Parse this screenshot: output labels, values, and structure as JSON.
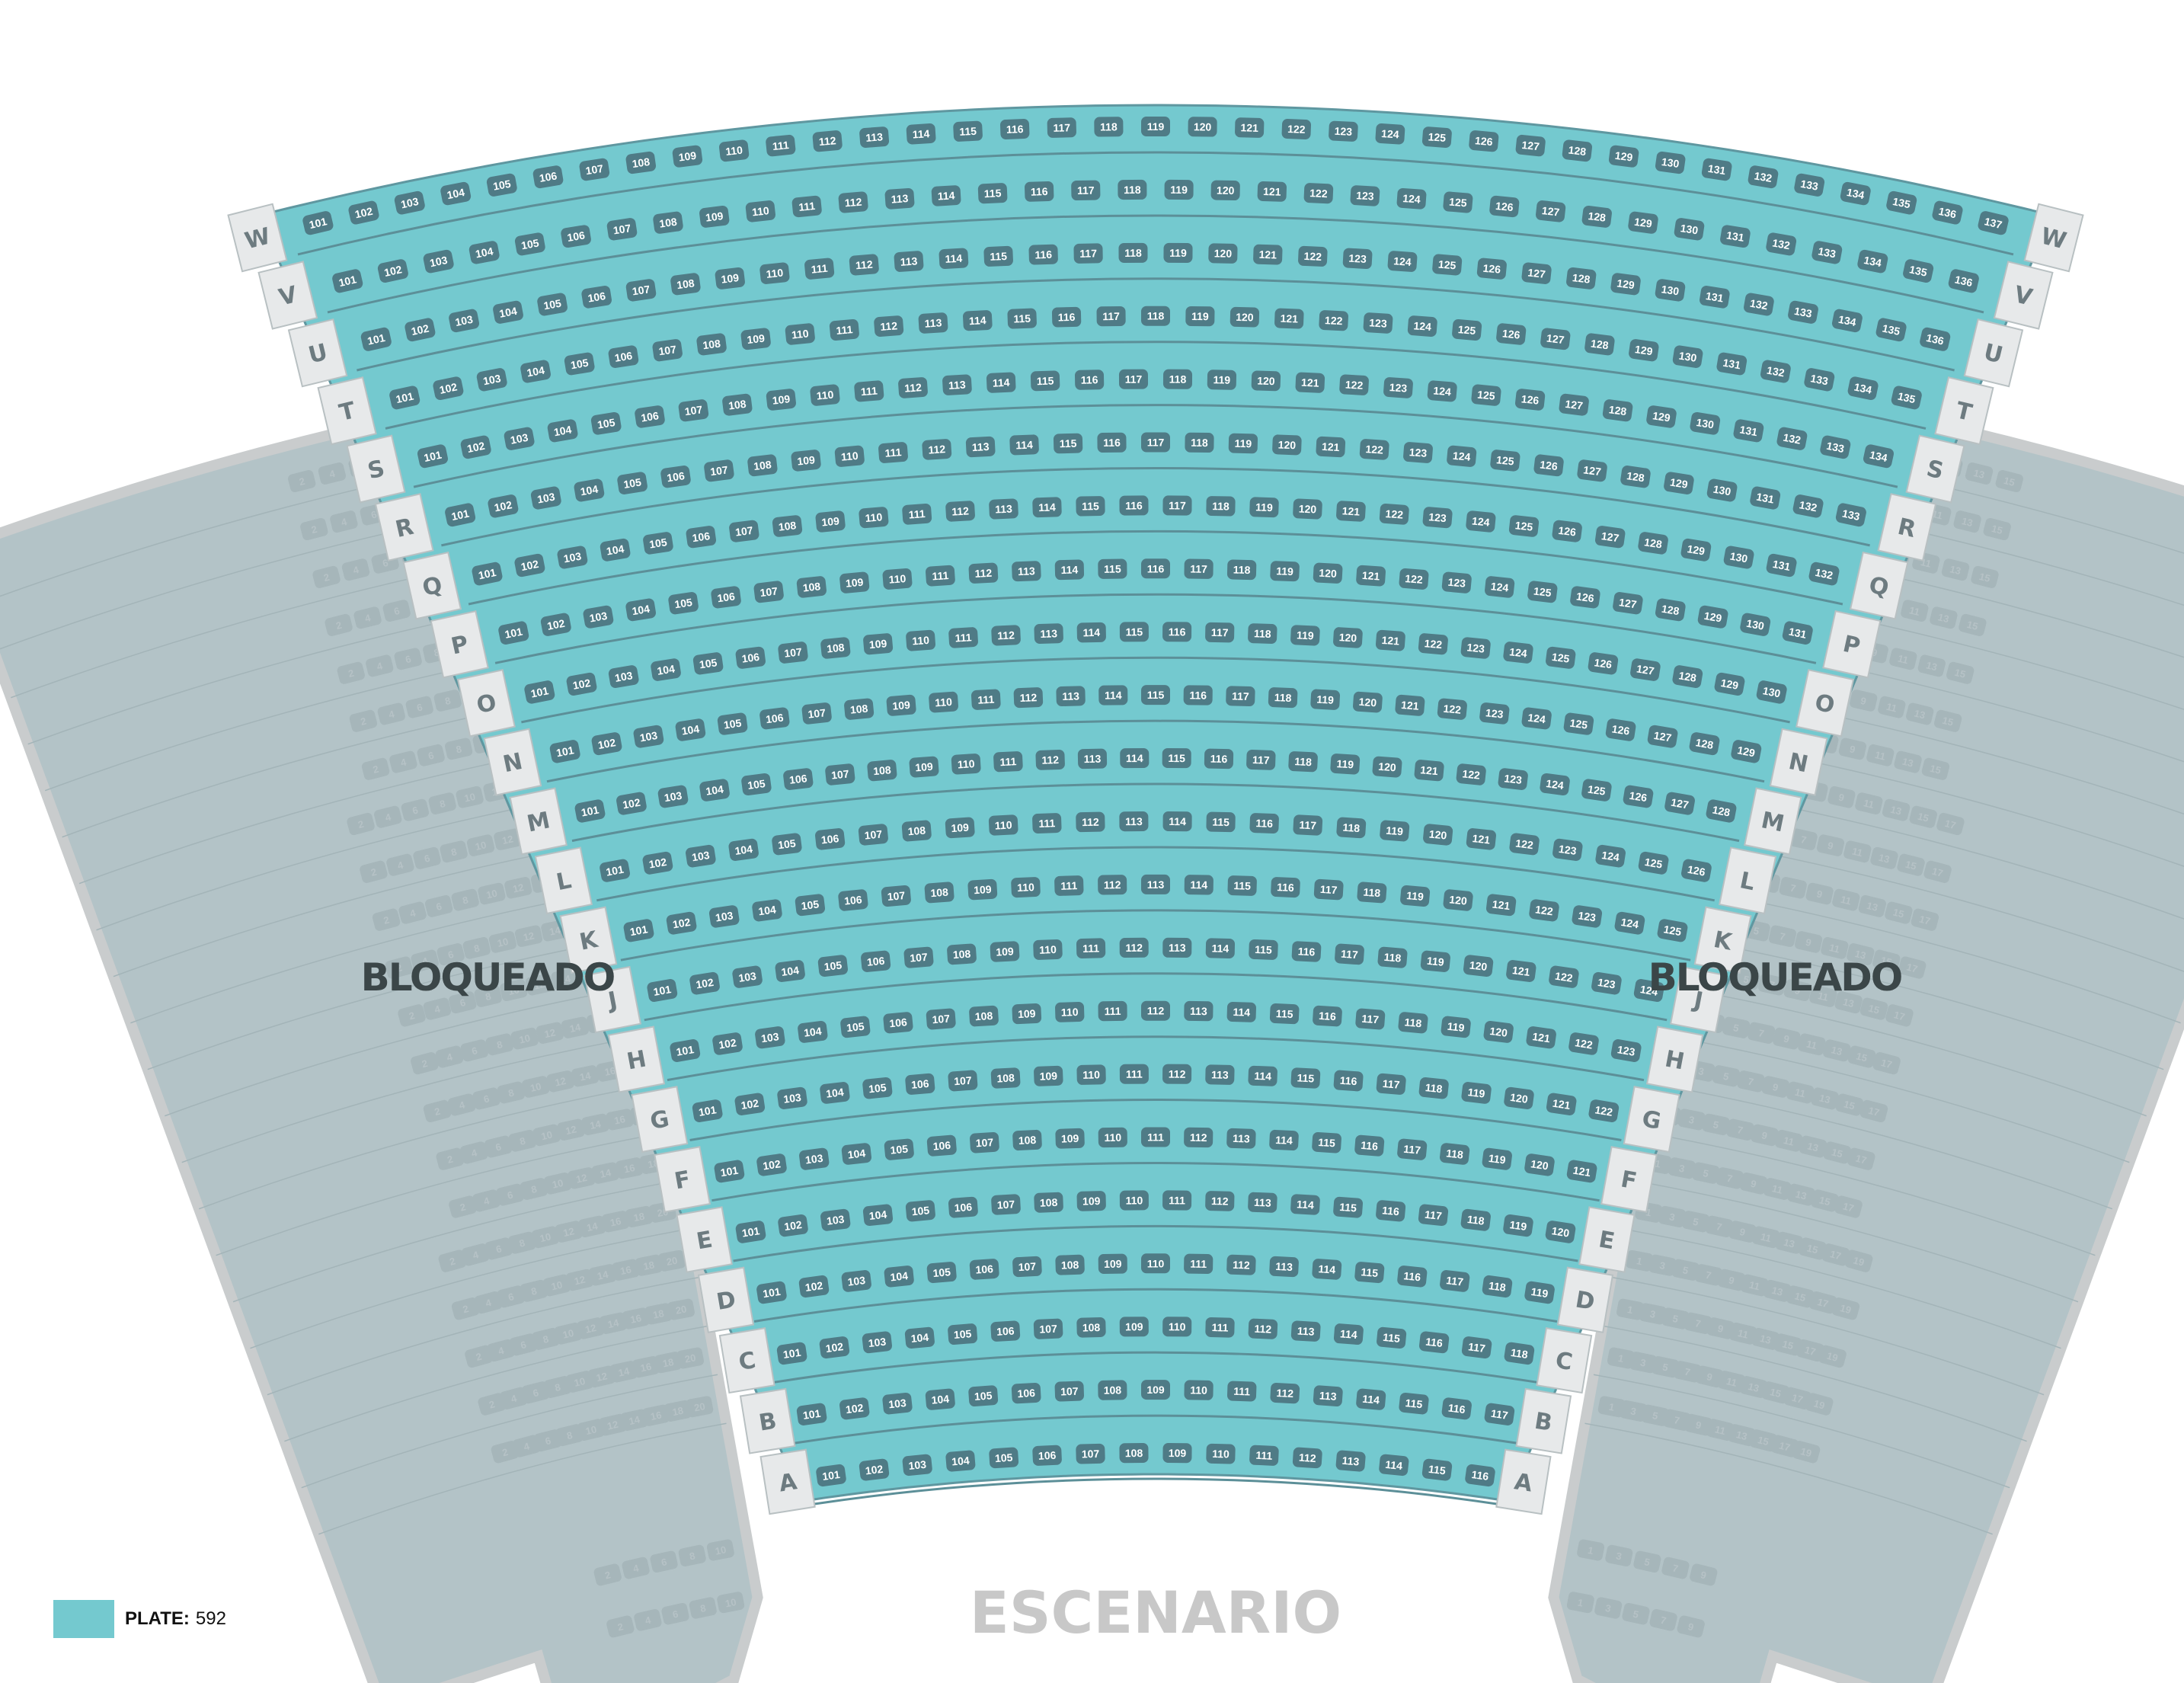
{
  "colors": {
    "plate": "#74c9cf",
    "plate_seat": "#4f7b86",
    "plate_row_rule": "#5c8f98",
    "blocked_fill": "#b3c3c7",
    "blocked_border": "#c9cccd",
    "blocked_seat": "#a6b6ba",
    "row_label_bg": "#e7e9ea",
    "row_label_border": "#b8c0c2",
    "blocked_text": "#3b4648",
    "stage_text": "#c8c8c8"
  },
  "labels": {
    "blocked_left": "BLOQUEADO",
    "blocked_right": "BLOQUEADO",
    "stage": "ESCENARIO"
  },
  "legend": {
    "label": "PLATE:",
    "value": "592",
    "swatch_color": "#74c9cf"
  },
  "plate_section": {
    "rows": [
      {
        "row": "W",
        "seats": 37
      },
      {
        "row": "V",
        "seats": 36
      },
      {
        "row": "U",
        "seats": 36
      },
      {
        "row": "T",
        "seats": 35
      },
      {
        "row": "S",
        "seats": 34
      },
      {
        "row": "R",
        "seats": 33
      },
      {
        "row": "Q",
        "seats": 32
      },
      {
        "row": "P",
        "seats": 31
      },
      {
        "row": "O",
        "seats": 30
      },
      {
        "row": "N",
        "seats": 29
      },
      {
        "row": "M",
        "seats": 28
      },
      {
        "row": "L",
        "seats": 26
      },
      {
        "row": "K",
        "seats": 25
      },
      {
        "row": "J",
        "seats": 24
      },
      {
        "row": "H",
        "seats": 23
      },
      {
        "row": "G",
        "seats": 22
      },
      {
        "row": "F",
        "seats": 21
      },
      {
        "row": "E",
        "seats": 20
      },
      {
        "row": "D",
        "seats": 19
      },
      {
        "row": "C",
        "seats": 18
      },
      {
        "row": "B",
        "seats": 17
      },
      {
        "row": "A",
        "seats": 16
      }
    ],
    "first_seat_number": 101
  },
  "blocked_left": {
    "rows": [
      [
        "16",
        "14",
        "12",
        "10",
        "8",
        "6",
        "4",
        "2"
      ],
      [
        "16",
        "14",
        "12",
        "10",
        "8",
        "6",
        "4",
        "2"
      ],
      [
        "16",
        "14",
        "12",
        "10",
        "8",
        "6",
        "4",
        "2"
      ],
      [
        "16",
        "14",
        "12",
        "10",
        "8",
        "6",
        "4",
        "2"
      ],
      [
        "16",
        "14",
        "12",
        "10",
        "8",
        "6",
        "4",
        "2"
      ],
      [
        "16",
        "14",
        "12",
        "10",
        "8",
        "6",
        "4",
        "2"
      ],
      [
        "16",
        "14",
        "12",
        "10",
        "8",
        "6",
        "4",
        "2"
      ],
      [
        "18",
        "16",
        "14",
        "12",
        "10",
        "8",
        "6",
        "4",
        "2"
      ],
      [
        "18",
        "16",
        "14",
        "12",
        "10",
        "8",
        "6",
        "4",
        "2"
      ],
      [
        "18",
        "16",
        "14",
        "12",
        "10",
        "8",
        "6",
        "4",
        "2"
      ],
      [
        "18",
        "16",
        "14",
        "12",
        "10",
        "8",
        "6",
        "4",
        "2"
      ],
      [
        "18",
        "16",
        "14",
        "12",
        "10",
        "8",
        "6",
        "4",
        "2"
      ],
      [
        "18",
        "16",
        "14",
        "12",
        "10",
        "8",
        "6",
        "4",
        "2"
      ],
      [
        "18",
        "16",
        "14",
        "12",
        "10",
        "8",
        "6",
        "4",
        "2"
      ],
      [
        "18",
        "16",
        "14",
        "12",
        "10",
        "8",
        "6",
        "4",
        "2"
      ],
      [
        "18",
        "16",
        "14",
        "12",
        "10",
        "8",
        "6",
        "4",
        "2"
      ],
      [
        "20",
        "18",
        "16",
        "14",
        "12",
        "10",
        "8",
        "6",
        "4",
        "2"
      ],
      [
        "20",
        "18",
        "16",
        "14",
        "12",
        "10",
        "8",
        "6",
        "4",
        "2"
      ],
      [
        "20",
        "18",
        "16",
        "14",
        "12",
        "10",
        "8",
        "6",
        "4",
        "2"
      ],
      [
        "20",
        "18",
        "16",
        "14",
        "12",
        "10",
        "8",
        "6",
        "4",
        "2"
      ],
      [
        "20",
        "18",
        "16",
        "14",
        "12",
        "10",
        "8",
        "6",
        "4",
        "2"
      ]
    ],
    "lower_rows": [
      [
        "10",
        "8",
        "6",
        "4",
        "2"
      ],
      [
        "10",
        "8",
        "6",
        "4",
        "2"
      ]
    ]
  },
  "blocked_right": {
    "rows": [
      [
        "1",
        "3",
        "5",
        "7",
        "9",
        "11",
        "13",
        "15"
      ],
      [
        "1",
        "3",
        "5",
        "7",
        "9",
        "11",
        "13",
        "15"
      ],
      [
        "1",
        "3",
        "5",
        "7",
        "9",
        "11",
        "13",
        "15"
      ],
      [
        "1",
        "3",
        "5",
        "7",
        "9",
        "11",
        "13",
        "15"
      ],
      [
        "1",
        "3",
        "5",
        "7",
        "9",
        "11",
        "13",
        "15"
      ],
      [
        "1",
        "3",
        "5",
        "7",
        "9",
        "11",
        "13",
        "15"
      ],
      [
        "1",
        "3",
        "5",
        "7",
        "9",
        "11",
        "13",
        "15"
      ],
      [
        "1",
        "3",
        "5",
        "7",
        "9",
        "11",
        "13",
        "15",
        "17"
      ],
      [
        "1",
        "3",
        "5",
        "7",
        "9",
        "11",
        "13",
        "15",
        "17"
      ],
      [
        "1",
        "3",
        "5",
        "7",
        "9",
        "11",
        "13",
        "15",
        "17"
      ],
      [
        "1",
        "3",
        "5",
        "7",
        "9",
        "11",
        "13",
        "15",
        "17"
      ],
      [
        "1",
        "3",
        "5",
        "7",
        "9",
        "11",
        "13",
        "15",
        "17"
      ],
      [
        "1",
        "3",
        "5",
        "7",
        "9",
        "11",
        "13",
        "15",
        "17"
      ],
      [
        "1",
        "3",
        "5",
        "7",
        "9",
        "11",
        "13",
        "15",
        "17"
      ],
      [
        "1",
        "3",
        "5",
        "7",
        "9",
        "11",
        "13",
        "15",
        "17"
      ],
      [
        "1",
        "3",
        "5",
        "7",
        "9",
        "11",
        "13",
        "15",
        "17"
      ],
      [
        "1",
        "3",
        "5",
        "7",
        "9",
        "11",
        "13",
        "15",
        "17",
        "19"
      ],
      [
        "1",
        "3",
        "5",
        "7",
        "9",
        "11",
        "13",
        "15",
        "17",
        "19"
      ],
      [
        "1",
        "3",
        "5",
        "7",
        "9",
        "11",
        "13",
        "15",
        "17",
        "19"
      ],
      [
        "1",
        "3",
        "5",
        "7",
        "9",
        "11",
        "13",
        "15",
        "17",
        "19"
      ],
      [
        "1",
        "3",
        "5",
        "7",
        "9",
        "11",
        "13",
        "15",
        "17",
        "19"
      ]
    ],
    "lower_rows": [
      [
        "1",
        "3",
        "5",
        "7",
        "9"
      ],
      [
        "1",
        "3",
        "5",
        "7",
        "9"
      ]
    ]
  }
}
